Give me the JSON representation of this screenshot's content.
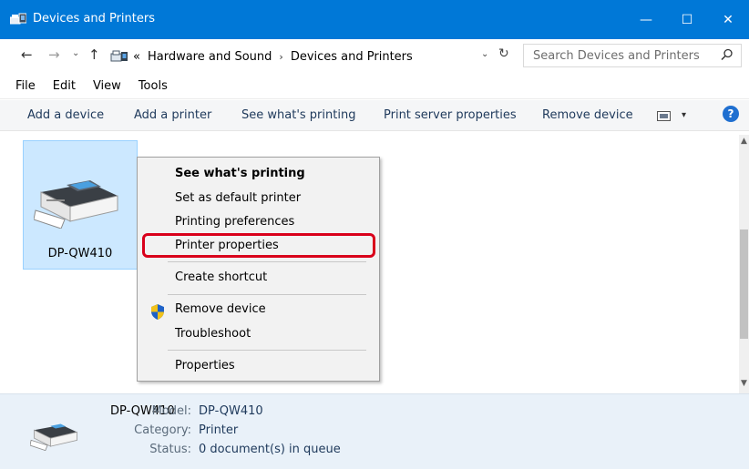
{
  "window": {
    "title": "Devices and Printers",
    "min_glyph": "—",
    "max_glyph": "☐",
    "close_glyph": "✕"
  },
  "nav": {
    "back": "←",
    "forward": "→",
    "recent": "⌄",
    "up": "↑"
  },
  "address": {
    "overflow": "«",
    "crumbs": [
      "Hardware and Sound",
      "Devices and Printers"
    ],
    "separator": "›",
    "dropdown": "⌄",
    "refresh": "↻"
  },
  "search": {
    "placeholder": "Search Devices and Printers"
  },
  "menubar": [
    "File",
    "Edit",
    "View",
    "Tools"
  ],
  "commands": [
    "Add a device",
    "Add a printer",
    "See what's printing",
    "Print server properties",
    "Remove device"
  ],
  "view_dropdown": "▾",
  "help": "?",
  "device": {
    "name": "DP-QW410"
  },
  "context_menu": [
    "See what's printing",
    "Set as default printer",
    "Printing preferences",
    "Printer properties",
    "Create shortcut",
    "Remove device",
    "Troubleshoot",
    "Properties"
  ],
  "scroll": {
    "up": "▲",
    "down": "▼"
  },
  "details": {
    "name": "DP-QW410",
    "model_label": "Model:",
    "model": "DP-QW410",
    "category_label": "Category:",
    "category": "Printer",
    "status_label": "Status:",
    "status": "0 document(s) in queue"
  },
  "colors": {
    "titlebar": "#0078d7",
    "selection": "#cce8ff",
    "highlight": "#d9001b",
    "details_bg": "#e9f1f9"
  }
}
